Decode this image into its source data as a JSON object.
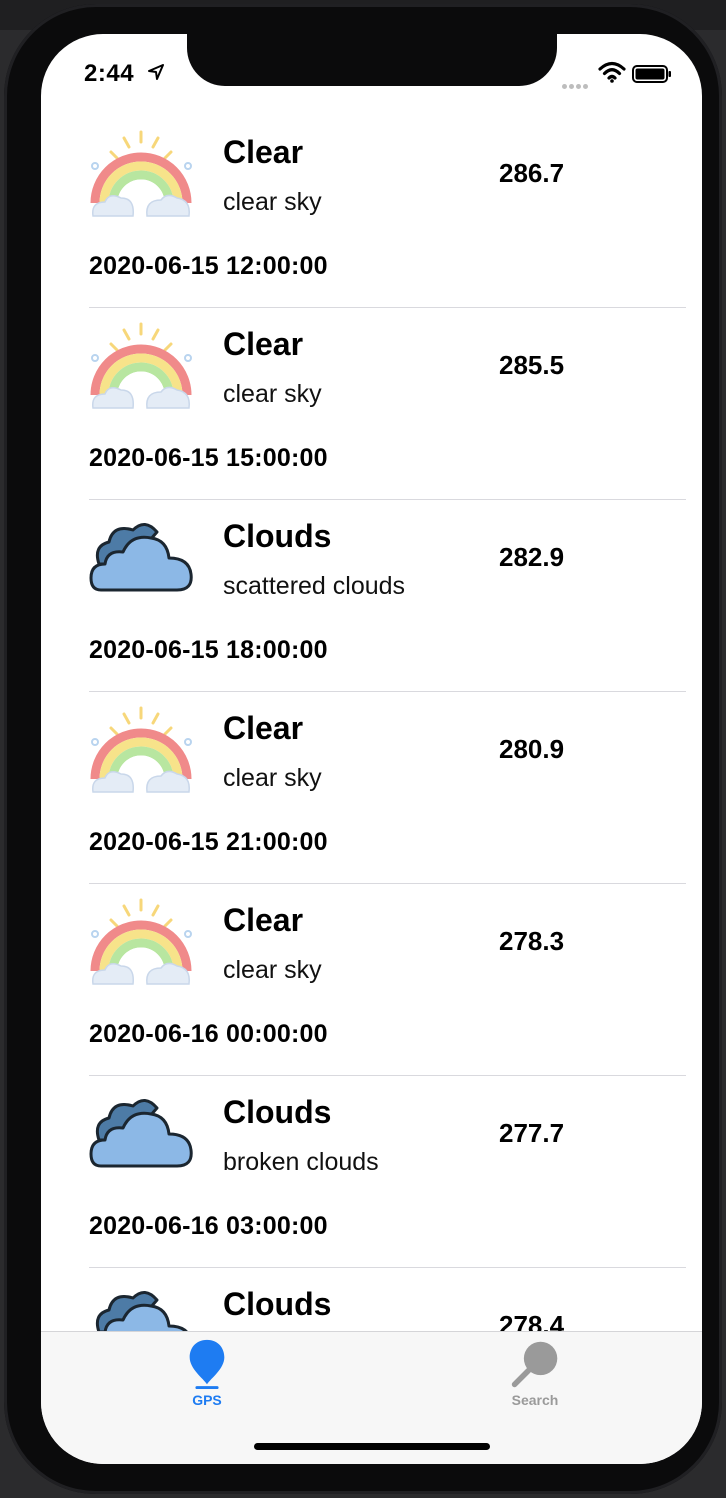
{
  "status_bar": {
    "time": "2:44"
  },
  "forecast": [
    {
      "main": "Clear",
      "description": "clear sky",
      "temp": "286.7",
      "datetime": "2020-06-15 12:00:00",
      "icon": "rainbow-icon"
    },
    {
      "main": "Clear",
      "description": "clear sky",
      "temp": "285.5",
      "datetime": "2020-06-15 15:00:00",
      "icon": "rainbow-icon"
    },
    {
      "main": "Clouds",
      "description": "scattered clouds",
      "temp": "282.9",
      "datetime": "2020-06-15 18:00:00",
      "icon": "cloud-icon"
    },
    {
      "main": "Clear",
      "description": "clear sky",
      "temp": "280.9",
      "datetime": "2020-06-15 21:00:00",
      "icon": "rainbow-icon"
    },
    {
      "main": "Clear",
      "description": "clear sky",
      "temp": "278.3",
      "datetime": "2020-06-16 00:00:00",
      "icon": "rainbow-icon"
    },
    {
      "main": "Clouds",
      "description": "broken clouds",
      "temp": "277.7",
      "datetime": "2020-06-16 03:00:00",
      "icon": "cloud-icon"
    },
    {
      "main": "Clouds",
      "description": "",
      "temp": "278.4",
      "datetime": "",
      "icon": "cloud-icon"
    }
  ],
  "tabs": [
    {
      "label": "GPS",
      "icon": "map-pin-icon",
      "active": true
    },
    {
      "label": "Search",
      "icon": "magnifier-icon",
      "active": false
    }
  ],
  "colors": {
    "tab_active": "#1e7cf2",
    "tab_inactive": "#9a9a9a",
    "cloud_fill": "#8cb8e6"
  }
}
